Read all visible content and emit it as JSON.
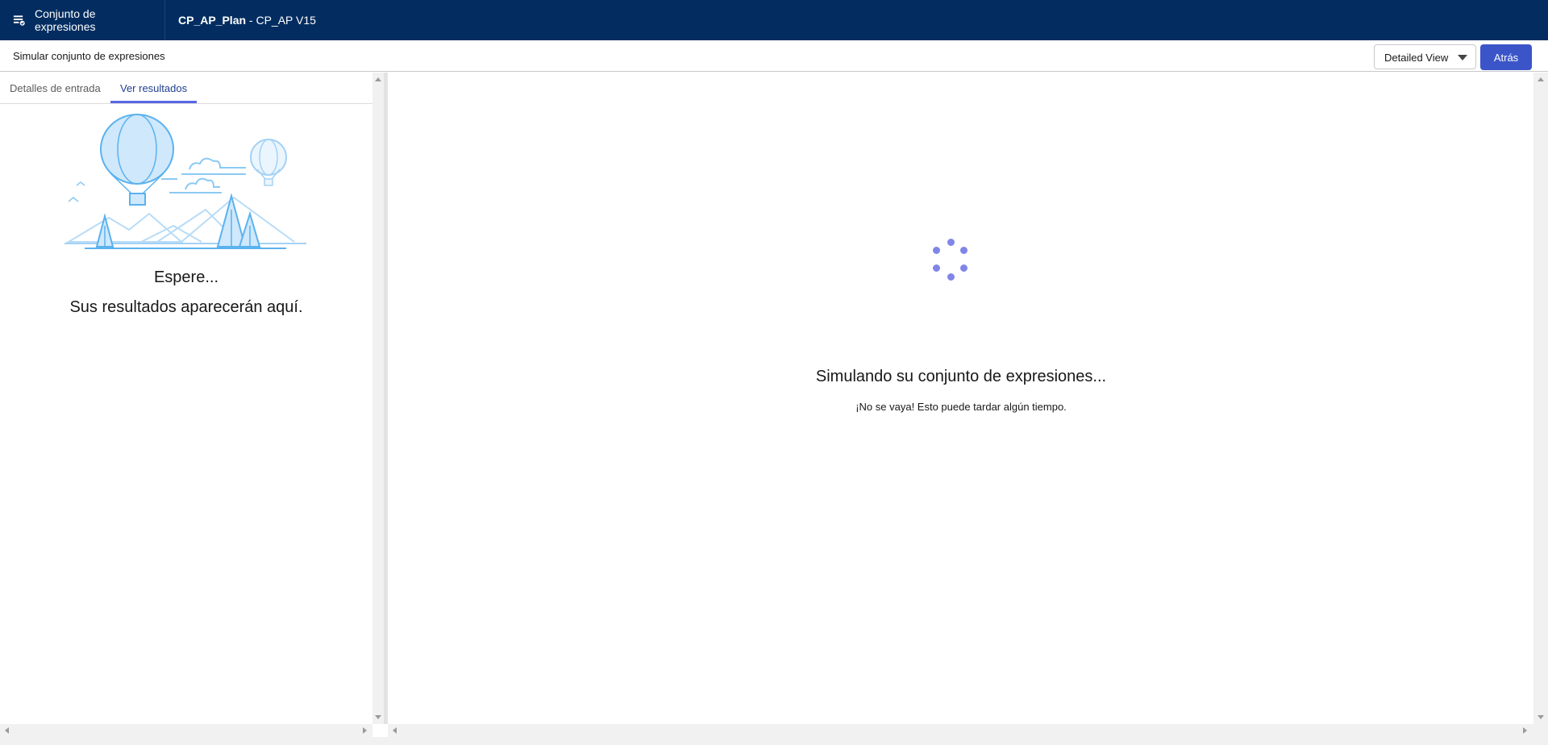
{
  "header": {
    "app_title": "Conjunto de expresiones",
    "record_name": "CP_AP_Plan",
    "record_suffix": " - CP_AP V15",
    "background_color": "#032d60"
  },
  "subheader": {
    "title": "Simular conjunto de expresiones",
    "view_select_value": "Detailed View",
    "back_label": "Atrás",
    "back_color": "#3b55c9"
  },
  "left_panel": {
    "tabs": [
      {
        "label": "Detalles de entrada",
        "active": false
      },
      {
        "label": "Ver resultados",
        "active": true
      }
    ],
    "wait_title": "Espere...",
    "wait_subtitle": "Sus resultados aparecerán aquí."
  },
  "main": {
    "spinner_color": "#8085e8",
    "title": "Simulando su conjunto de expresiones...",
    "subtitle": "¡No se vaya! Esto puede tardar algún tiempo."
  },
  "icons": [
    "expression-set-icon",
    "balloon-illustration",
    "loading-spinner-icon",
    "chevron-down-icon"
  ]
}
